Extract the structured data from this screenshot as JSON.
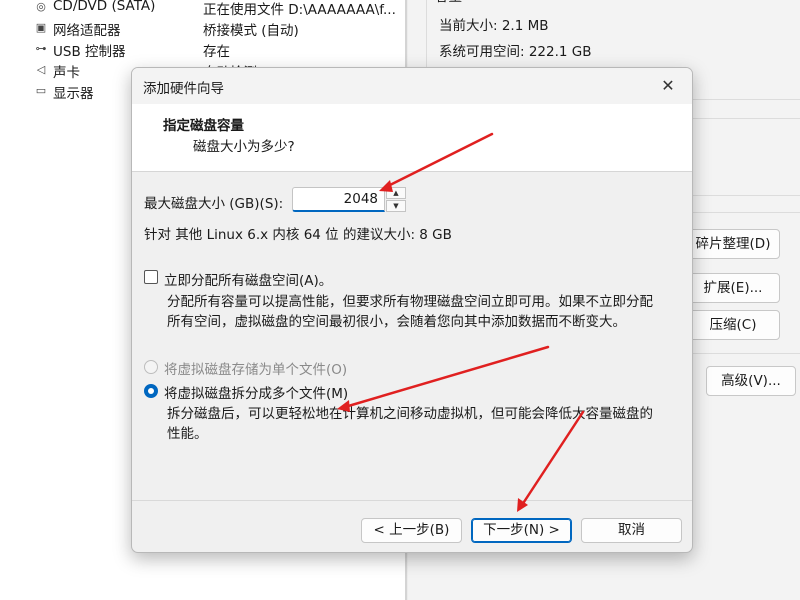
{
  "devices": [
    {
      "icon": "cd-dvd-icon",
      "glyph": "◎",
      "name": "CD/DVD (SATA)",
      "summary": "正在使用文件 D:\\AAAAAAA\\f..."
    },
    {
      "icon": "network-adapter-icon",
      "glyph": "▣",
      "name": "网络适配器",
      "summary": "桥接模式 (自动)"
    },
    {
      "icon": "usb-controller-icon",
      "glyph": "⊶",
      "name": "USB 控制器",
      "summary": "存在"
    },
    {
      "icon": "sound-card-icon",
      "glyph": "◁",
      "name": "声卡",
      "summary": "自动检测"
    },
    {
      "icon": "display-icon",
      "glyph": "▭",
      "name": "显示器",
      "summary": ""
    }
  ],
  "disk_info": {
    "group_label": "容量",
    "current_size": "当前大小: 2.1 MB",
    "available_space": "系统可用空间: 222.1 GB"
  },
  "side_buttons": {
    "defragment": "碎片整理(D)",
    "expand": "扩展(E)...",
    "compact": "压缩(C)",
    "advanced": "高级(V)..."
  },
  "dialog": {
    "title": "添加硬件向导",
    "close_glyph": "✕",
    "header_title": "指定磁盘容量",
    "header_subtitle": "磁盘大小为多少?",
    "max_size_label": "最大磁盘大小 (GB)(S):",
    "max_size_value": "2048",
    "recommended": "针对 其他 Linux 6.x 内核 64 位 的建议大小: 8 GB",
    "allocate_label": "立即分配所有磁盘空间(A)。",
    "allocate_checked": false,
    "allocate_desc_1": "分配所有容量可以提高性能，但要求所有物理磁盘空间立即可用。如果不立即分配",
    "allocate_desc_2": "所有空间，虚拟磁盘的空间最初很小，会随着您向其中添加数据而不断变大。",
    "single_file_label": "将虚拟磁盘存储为单个文件(O)",
    "multi_file_label": "将虚拟磁盘拆分成多个文件(M)",
    "selected_option": "multi_file",
    "multi_desc_1": "拆分磁盘后，可以更轻松地在计算机之间移动虚拟机，但可能会降低大容量磁盘的",
    "multi_desc_2": "性能。",
    "back_button": "< 上一步(B)",
    "next_button": "下一步(N) >",
    "cancel_button": "取消"
  },
  "colors": {
    "accent": "#0067c0",
    "annotation_arrow": "#e02020"
  }
}
